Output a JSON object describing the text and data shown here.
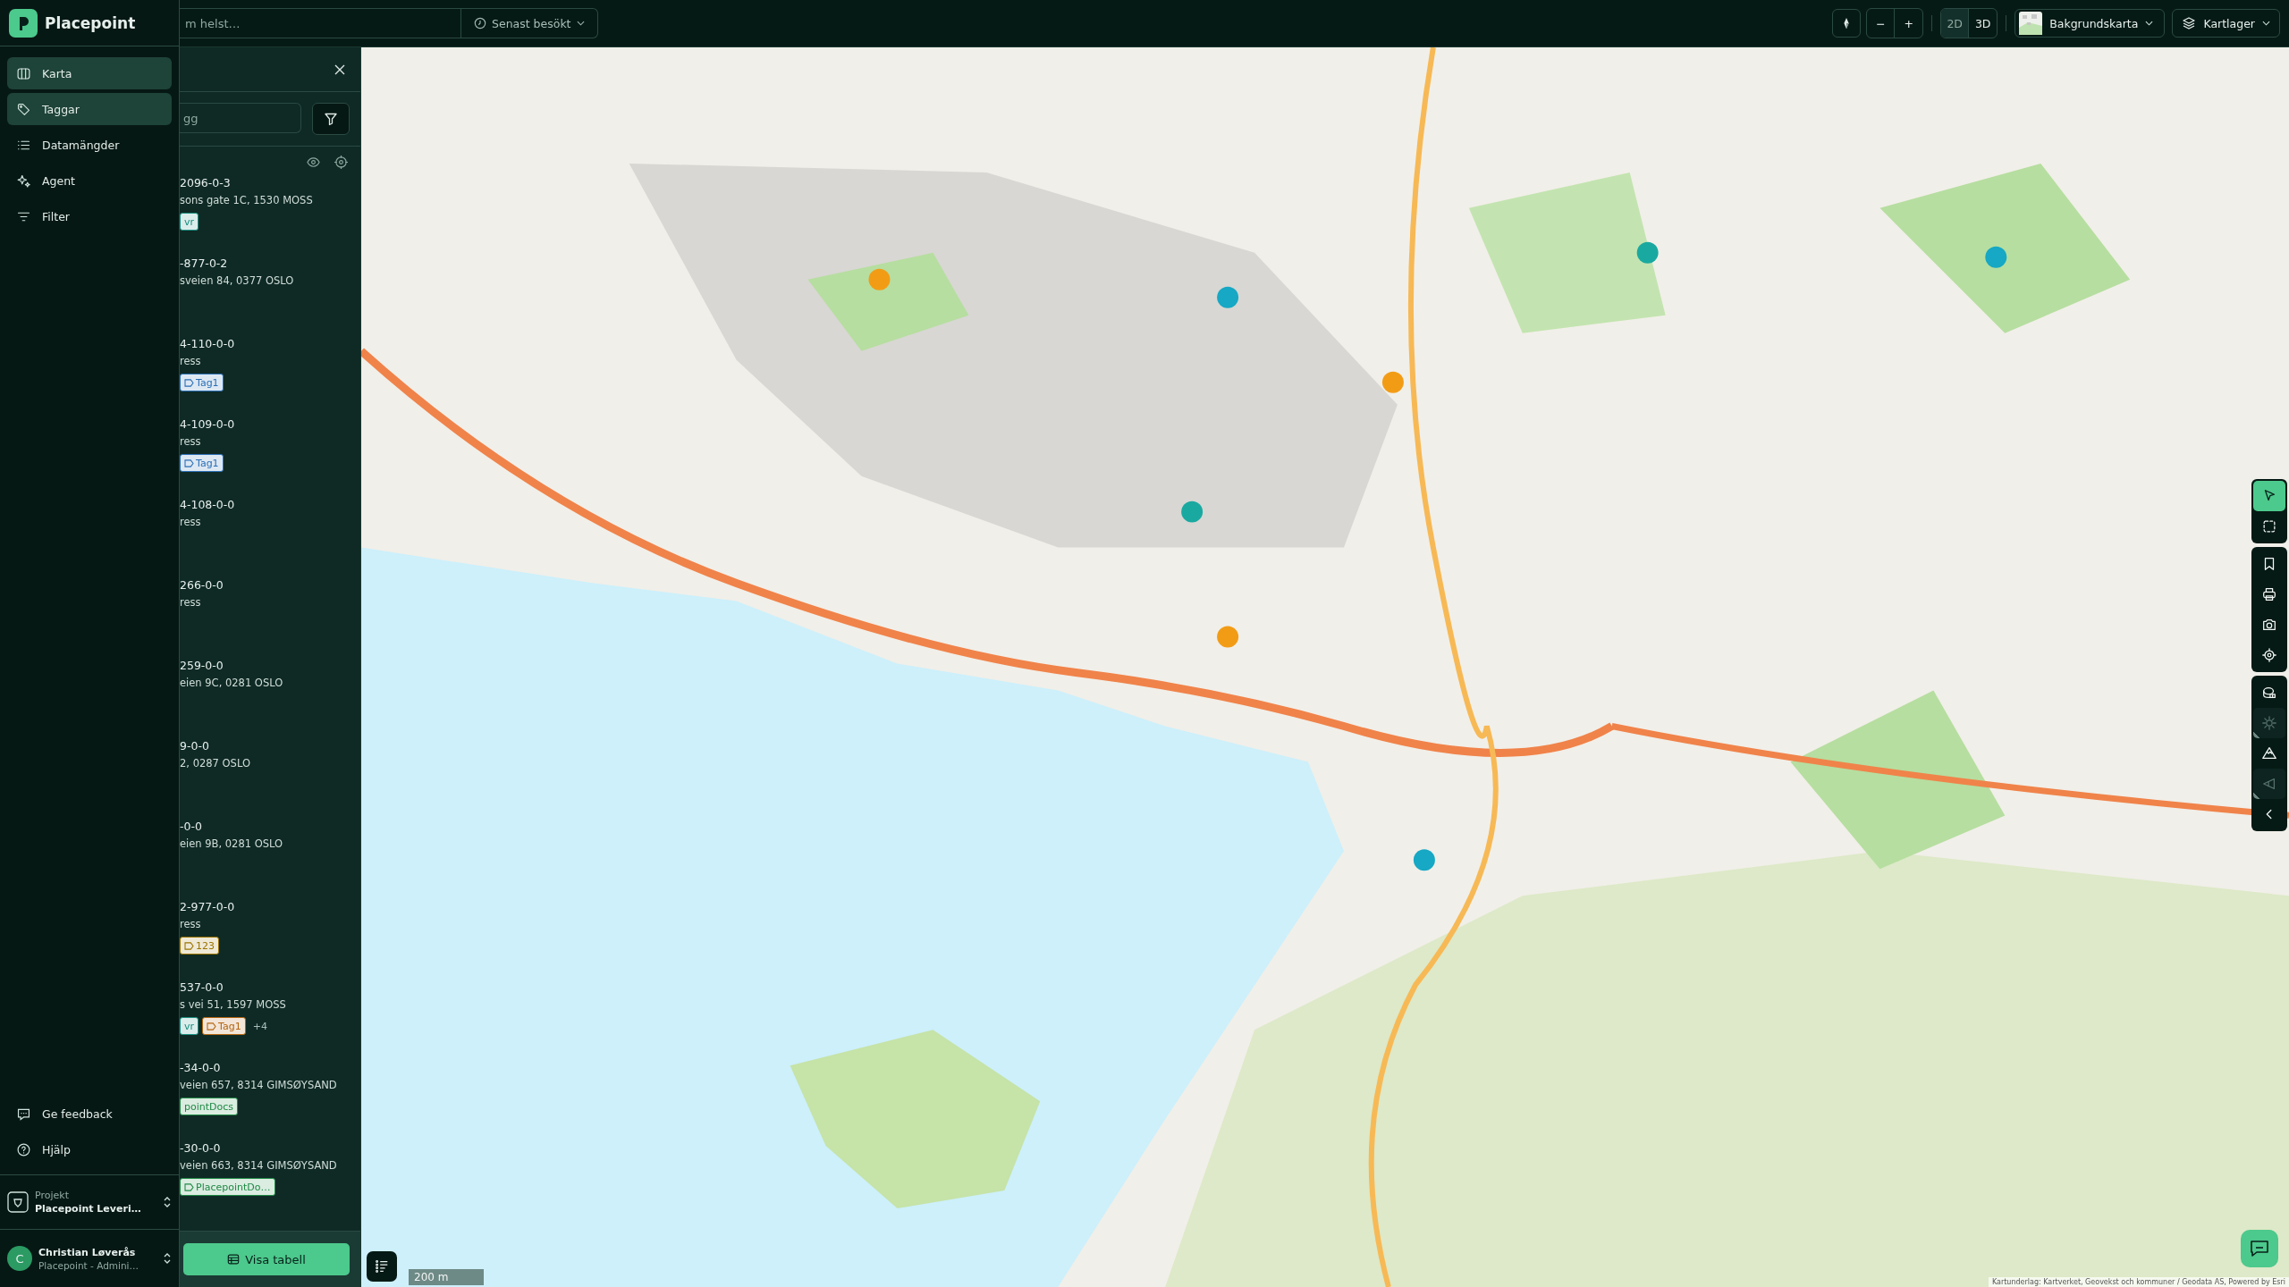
{
  "app": {
    "name": "Placepoint"
  },
  "nav": [
    {
      "label": "Karta",
      "kind": "map",
      "selected": true
    },
    {
      "label": "Taggar",
      "kind": "tag",
      "selected": true
    },
    {
      "label": "Datamängder",
      "kind": "list",
      "selected": false
    },
    {
      "label": "Agent",
      "kind": "sparkle",
      "selected": false
    },
    {
      "label": "Filter",
      "kind": "filter",
      "selected": false
    }
  ],
  "footer_links": [
    {
      "label": "Ge feedback",
      "kind": "feedback"
    },
    {
      "label": "Hjälp",
      "kind": "help"
    }
  ],
  "project": {
    "caption": "Projekt",
    "name": "Placepoint Leveri…"
  },
  "user": {
    "initial": "C",
    "name": "Christian Løverås",
    "role": "Placepoint - Admini…"
  },
  "search": {
    "placeholder": "m helst…"
  },
  "recent": {
    "label": "Senast besökt"
  },
  "map_controls": {
    "zoom_out": "−",
    "zoom_in": "+",
    "modes": [
      {
        "label": "2D",
        "selected": true
      },
      {
        "label": "3D",
        "selected": false
      }
    ],
    "basemap": "Bakgrundskarta",
    "layers": "Kartlager"
  },
  "panel": {
    "search_placeholder": "gg",
    "button": "Visa tabell",
    "items": [
      {
        "id": "2096-0-3",
        "address": "sons gate 1C, 1530 MOSS",
        "tags": [
          {
            "label": "vr",
            "color": "#1a8f80",
            "icon": false
          }
        ]
      },
      {
        "id": "-877-0-2",
        "address": "sveien 84, 0377 OSLO"
      },
      {
        "id": "4-110-0-0",
        "address": "ress",
        "tags": [
          {
            "label": "Tag1",
            "color": "#2a6fb5",
            "icon": true
          }
        ]
      },
      {
        "id": "4-109-0-0",
        "address": "ress",
        "tags": [
          {
            "label": "Tag1",
            "color": "#2a6fb5",
            "icon": true
          }
        ]
      },
      {
        "id": "4-108-0-0",
        "address": "ress"
      },
      {
        "id": "266-0-0",
        "address": "ress"
      },
      {
        "id": "259-0-0",
        "address": "eien 9C, 0281 OSLO"
      },
      {
        "id": "9-0-0",
        "address": "2, 0287 OSLO"
      },
      {
        "id": "-0-0",
        "address": "eien 9B, 0281 OSLO"
      },
      {
        "id": "2-977-0-0",
        "address": "ress",
        "tags": [
          {
            "label": "123",
            "color": "#9a7300",
            "icon": true
          }
        ]
      },
      {
        "id": "537-0-0",
        "address": "s vei 51, 1597 MOSS",
        "tags": [
          {
            "label": "vr",
            "color": "#1a8f80",
            "icon": false
          },
          {
            "label": "Tag1",
            "color": "#b5650f",
            "icon": true
          }
        ],
        "more": "+4"
      },
      {
        "id": "-34-0-0",
        "address": "veien 657, 8314 GIMSØYSAND",
        "tags": [
          {
            "label": "pointDocs",
            "color": "#1f8a45",
            "icon": false
          }
        ]
      },
      {
        "id": "-30-0-0",
        "address": "veien 663, 8314 GIMSØYSAND",
        "tags": [
          {
            "label": "PlacepointDo…",
            "color": "#1f8a45",
            "icon": true
          }
        ]
      }
    ]
  },
  "tool_groups": [
    [
      {
        "kind": "pointer",
        "selected": true,
        "disabled": false
      },
      {
        "kind": "box",
        "selected": false,
        "disabled": false
      }
    ],
    [
      {
        "kind": "bookmark",
        "selected": false,
        "disabled": false
      },
      {
        "kind": "print",
        "selected": false,
        "disabled": false
      },
      {
        "kind": "camera",
        "selected": false,
        "disabled": false
      },
      {
        "kind": "target",
        "selected": false,
        "disabled": false
      }
    ],
    [
      {
        "kind": "measure",
        "selected": false,
        "disabled": false
      },
      {
        "kind": "sun",
        "selected": false,
        "disabled": true
      },
      {
        "kind": "mountain",
        "selected": false,
        "disabled": false
      },
      {
        "kind": "view",
        "selected": false,
        "disabled": true
      },
      {
        "kind": "collapse",
        "selected": false,
        "disabled": false
      }
    ]
  ],
  "scale": "200 m",
  "attribution": "Kartunderlag: Kartverket, Geovekst och kommuner / Geodata AS, Powered by Esri"
}
